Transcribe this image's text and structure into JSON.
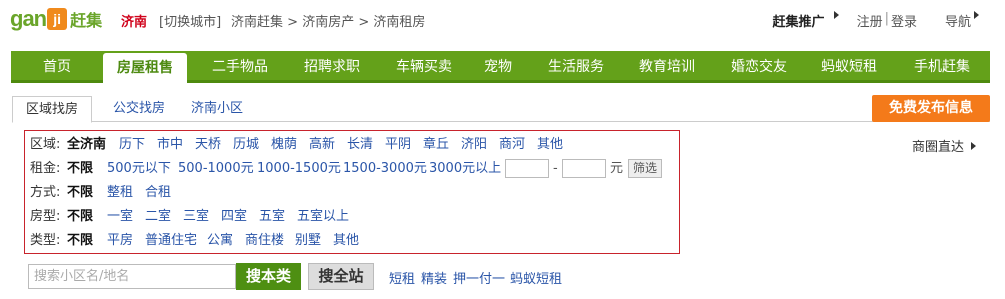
{
  "logo": {
    "text": "gan",
    "badge": "ji",
    "cn": "赶集"
  },
  "header": {
    "city": "济南",
    "switch_city": "[切换城市]",
    "breadcrumb": [
      "济南赶集",
      "济南房产",
      "济南租房"
    ],
    "breadcrumb_sep": ">",
    "promo": "赶集推广",
    "register": "注册",
    "login": "登录",
    "divider": "|",
    "nav_menu": "导航"
  },
  "nav": {
    "items": [
      "首页",
      "房屋租售",
      "二手物品",
      "招聘求职",
      "车辆买卖",
      "宠物",
      "生活服务",
      "教育培训",
      "婚恋交友",
      "蚂蚁短租",
      "手机赶集"
    ],
    "active_index": 1
  },
  "tabs": {
    "items": [
      "区域找房",
      "公交找房",
      "济南小区"
    ],
    "active_index": 0
  },
  "publish_button": "免费发布信息",
  "shortcut": "商圈直达",
  "filters": {
    "area": {
      "label": "区域:",
      "options": [
        "全济南",
        "历下",
        "市中",
        "天桥",
        "历城",
        "槐荫",
        "高新",
        "长清",
        "平阴",
        "章丘",
        "济阳",
        "商河",
        "其他"
      ]
    },
    "rent": {
      "label": "租金:",
      "options": [
        "不限",
        "500元以下",
        "500-1000元",
        "1000-1500元",
        "1500-3000元",
        "3000元以上"
      ],
      "dash": "-",
      "unit": "元",
      "filter_button": "筛选"
    },
    "mode": {
      "label": "方式:",
      "options": [
        "不限",
        "整租",
        "合租"
      ]
    },
    "layout": {
      "label": "房型:",
      "options": [
        "不限",
        "一室",
        "二室",
        "三室",
        "四室",
        "五室",
        "五室以上"
      ]
    },
    "type": {
      "label": "类型:",
      "options": [
        "不限",
        "平房",
        "普通住宅",
        "公寓",
        "商住楼",
        "别墅",
        "其他"
      ]
    }
  },
  "search": {
    "placeholder": "搜索小区名/地名",
    "search_this": "搜本类",
    "search_all": "搜全站",
    "quick_links": [
      "短租",
      "精装",
      "押一付一",
      "蚂蚁短租"
    ]
  },
  "colors": {
    "nav_green": "#64a11a",
    "orange": "#f47a1a",
    "border_red": "#c8232c",
    "link_blue": "#2a55a8"
  }
}
